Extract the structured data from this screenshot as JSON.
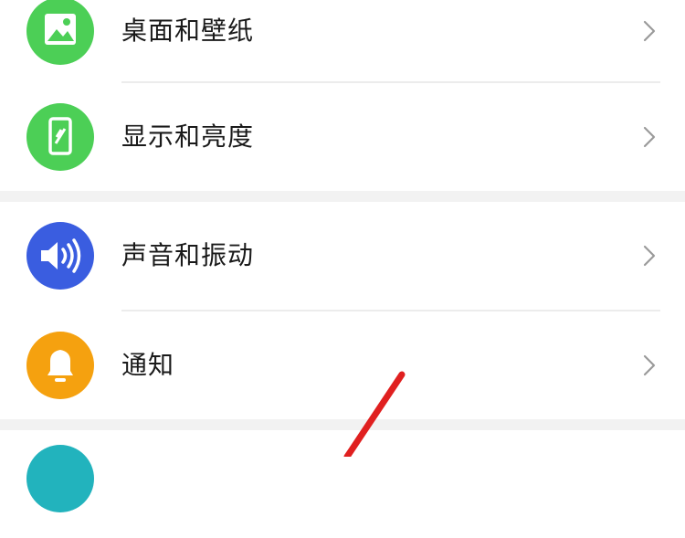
{
  "settings": {
    "items": [
      {
        "label": "桌面和壁纸",
        "icon": "wallpaper-icon",
        "color": "#4ccf56"
      },
      {
        "label": "显示和亮度",
        "icon": "display-brightness-icon",
        "color": "#4ccf56"
      },
      {
        "label": "声音和振动",
        "icon": "speaker-icon",
        "color": "#3a5de0"
      },
      {
        "label": "通知",
        "icon": "bell-icon",
        "color": "#f5a10f"
      },
      {
        "label": "",
        "icon": "partial-teal-icon",
        "color": "#22b3bd"
      }
    ]
  },
  "colors": {
    "divider": "#ececec",
    "group_gap": "#f2f2f2",
    "chevron": "#9a9a9a",
    "annotation_arrow": "#e02020"
  }
}
